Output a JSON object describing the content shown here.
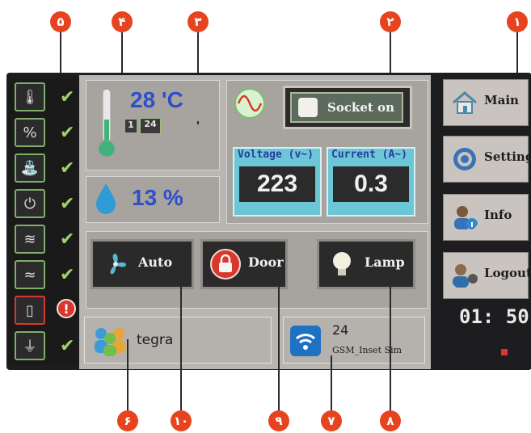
{
  "markers": {
    "m1": "١",
    "m2": "٢",
    "m3": "٣",
    "m4": "۴",
    "m5": "۵",
    "m6": "۶",
    "m7": "٧",
    "m8": "٨",
    "m9": "٩",
    "m10": "١٠"
  },
  "sidebar": {
    "items": [
      {
        "icon": "thermometer-icon",
        "state": "ok"
      },
      {
        "icon": "humidity-icon",
        "state": "ok"
      },
      {
        "icon": "faucet-icon",
        "state": "ok"
      },
      {
        "icon": "power-plug-icon",
        "state": "ok"
      },
      {
        "icon": "gas-burner-icon",
        "state": "ok"
      },
      {
        "icon": "vibration-icon",
        "state": "ok"
      },
      {
        "icon": "door-sensor-icon",
        "state": "alert"
      },
      {
        "icon": "ground-icon",
        "state": "ok"
      }
    ],
    "check_glyph": "✔",
    "alert_glyph": "!"
  },
  "temperature": {
    "value": "28 'C",
    "small_prefix": "1",
    "small_value": "24"
  },
  "humidity": {
    "value": "13 %"
  },
  "socket": {
    "label": "Socket on"
  },
  "voltage": {
    "title": "Voltage (v~)",
    "value": "223"
  },
  "current": {
    "title": "Current (A~)",
    "value": "0.3"
  },
  "controls": {
    "auto": "Auto",
    "door": "Door",
    "lamp": "Lamp"
  },
  "user": {
    "name": "tegra"
  },
  "gsm": {
    "signal": "24",
    "label": "GSM_Inset Sim"
  },
  "nav": {
    "main": "Main",
    "setting": "Setting",
    "info": "Info",
    "logout": "Logout"
  },
  "clock": "01: 50",
  "colors": {
    "marker": "#e8431f",
    "accent_blue": "#2f4fc9",
    "meter_cyan": "#6bc6d6",
    "alert_red": "#d9372b"
  }
}
